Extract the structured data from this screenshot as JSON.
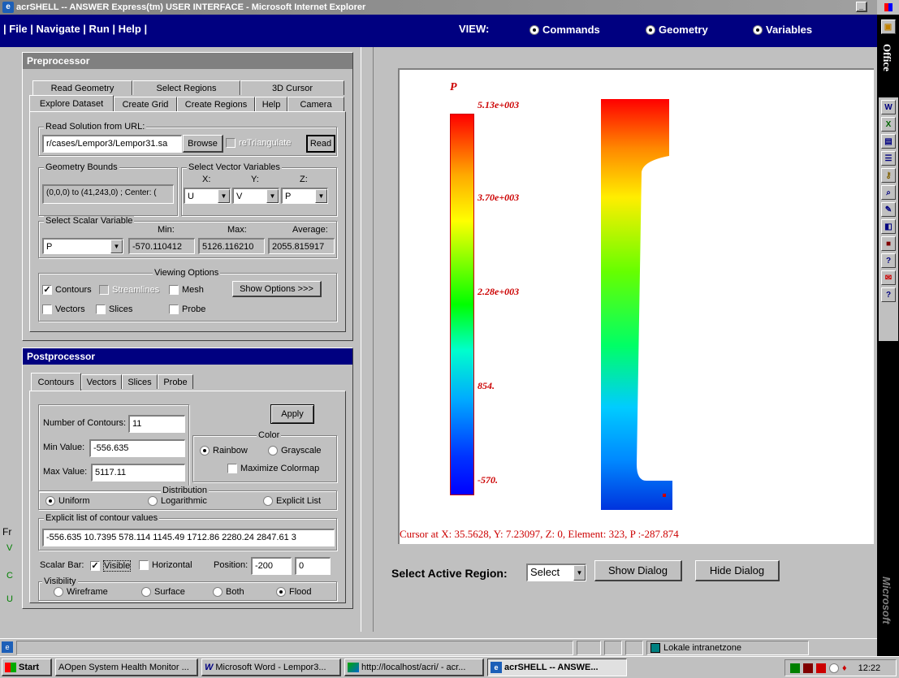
{
  "window": {
    "title": "acrSHELL -- ANSWER Express(tm) USER INTERFACE - Microsoft Internet Explorer"
  },
  "menu": {
    "label": "| File | Navigate | Run | Help |",
    "view_label": "VIEW:",
    "view_options": [
      "Commands",
      "Geometry",
      "Variables"
    ]
  },
  "pre": {
    "title": "Preprocessor",
    "tabs_row1": [
      "Read Geometry",
      "Select Regions",
      "3D Cursor"
    ],
    "tabs_row2": [
      "Explore Dataset",
      "Create Grid",
      "Create Regions",
      "Help",
      "Camera"
    ],
    "read_group": "Read Solution from URL:",
    "url": "r/cases/Lempor3/Lempor31.sa",
    "browse": "Browse",
    "retriangulate": "reTriangulate",
    "read": "Read",
    "bounds_group": "Geometry Bounds",
    "bounds_value": "(0,0,0) to (41,243,0) ; Center: (",
    "vector_group": "Select Vector Variables",
    "x_label": "X:",
    "y_label": "Y:",
    "z_label": "Z:",
    "x_val": "U",
    "y_val": "V",
    "z_val": "P",
    "scalar_group": "Select Scalar Variable",
    "scalar_val": "P",
    "min_label": "Min:",
    "max_label": "Max:",
    "avg_label": "Average:",
    "min_val": "-570.110412",
    "max_val": "5126.116210",
    "avg_val": "2055.815917",
    "viewing_group": "Viewing Options",
    "contours": "Contours",
    "streamlines": "Streamlines",
    "mesh": "Mesh",
    "show_options": "Show Options >>>",
    "vectors": "Vectors",
    "slices": "Slices",
    "probe": "Probe"
  },
  "post": {
    "title": "Postprocessor",
    "tabs": [
      "Contours",
      "Vectors",
      "Slices",
      "Probe"
    ],
    "num_label": "Number of Contours:",
    "num_val": "11",
    "min_label": "Min Value:",
    "min_val": "-556.635",
    "max_label": "Max Value:",
    "max_val": "5117.11",
    "apply": "Apply",
    "color_group": "Color",
    "rainbow": "Rainbow",
    "grayscale": "Grayscale",
    "maximize": "Maximize Colormap",
    "dist_group": "Distribution",
    "uniform": "Uniform",
    "logarithmic": "Logarithmic",
    "explicit": "Explicit List",
    "explicit_group": "Explicit list of contour values",
    "explicit_values": "-556.635 10.7395 578.114 1145.49 1712.86 2280.24 2847.61 3",
    "scalar_bar": "Scalar Bar:",
    "visible": "Visible",
    "horizontal": "Horizontal",
    "position": "Position:",
    "pos_x": "-200",
    "pos_y": "0",
    "visibility_group": "Visibility",
    "wireframe": "Wireframe",
    "surface": "Surface",
    "both": "Both",
    "flood": "Flood"
  },
  "viewer": {
    "var_label": "P",
    "ticks": [
      "5.13e+003",
      "3.70e+003",
      "2.28e+003",
      "854.",
      "-570."
    ],
    "cursor_text": "Cursor at X: 35.5628, Y: 7.23097, Z: 0, Element: 323, P  :-287.874",
    "select_label": "Select Active Region:",
    "select_val": "Select",
    "show_dialog": "Show Dialog",
    "hide_dialog": "Hide Dialog"
  },
  "left_strip": [
    "Fr",
    "V",
    "C",
    "U"
  ],
  "office": {
    "label": "Office",
    "brand": "Microsoft"
  },
  "status": {
    "zone": "Lokale intranetzone"
  },
  "taskbar": {
    "start": "Start",
    "items": [
      "AOpen System Health Monitor ...",
      "Microsoft Word - Lempor3...",
      "http://localhost/acri/ - acr...",
      "acrSHELL -- ANSWE..."
    ],
    "clock": "12:22"
  },
  "colors": {
    "title_bar": "#000080",
    "menu_bg": "#000080",
    "accent_red": "#cc0000"
  }
}
